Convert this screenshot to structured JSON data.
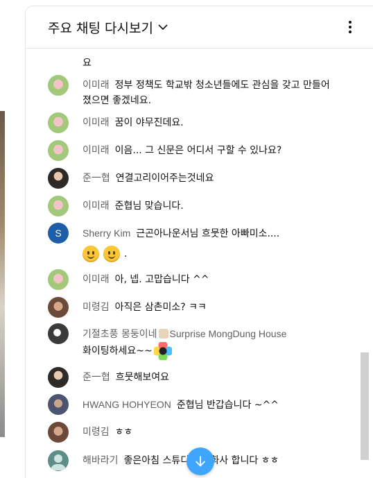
{
  "header": {
    "title": "주요 채팅 다시보기"
  },
  "cut_off_top_line": "요",
  "messages": [
    {
      "author": "이미래",
      "text": "정부 정책도 학교밖 청소년들에도 관심을 갖고 만들어 졌으면 좋겠네요.",
      "avatar": "pink"
    },
    {
      "author": "이미래",
      "text": "꿈이 야무진데요.",
      "avatar": "pink"
    },
    {
      "author": "이미래",
      "text": "이음... 그 신문은 어디서 구할 수 있나요?",
      "avatar": "pink"
    },
    {
      "author": "준一협",
      "text": "연결고리이어주는것네요",
      "avatar": "jun"
    },
    {
      "author": "이미래",
      "text": "준협님 맞습니다.",
      "avatar": "pink"
    },
    {
      "author": "Sherry Kim",
      "text": "근곤아나운서님 흐뭇한 아빠미소....",
      "tail": ".",
      "avatar": "S"
    },
    {
      "author": "이미래",
      "text": "아, 넵. 고맙습니다 ^^",
      "avatar": "pink"
    },
    {
      "author": "미령김",
      "text": "아직은 삼촌미소? ㅋㅋ",
      "avatar": "mi"
    },
    {
      "author": "기절초풍 몽둥이네",
      "author2": "Surprise MongDung House",
      "text": "화이팅하세요~~",
      "avatar": "gi"
    },
    {
      "author": "준一협",
      "text": "흐뭇해보여요",
      "avatar": "jun"
    },
    {
      "author": "HWANG HOHYEON",
      "text": "준협님 반갑습니다 ~^^",
      "avatar": "hw"
    },
    {
      "author": "미령김",
      "text": "ㅎㅎ",
      "avatar": "mi"
    },
    {
      "author": "해바라기",
      "text": "좋은아침 스튜디오가 화사 합니다 ㅎㅎ",
      "avatar": "hae"
    }
  ],
  "icons": {
    "more": "more-vert-icon",
    "dropdown": "chevron-down-icon",
    "scroll": "arrow-down-icon"
  },
  "colors": {
    "accent": "#3ea6ff",
    "author": "#606060",
    "text": "#0f0f0f"
  }
}
